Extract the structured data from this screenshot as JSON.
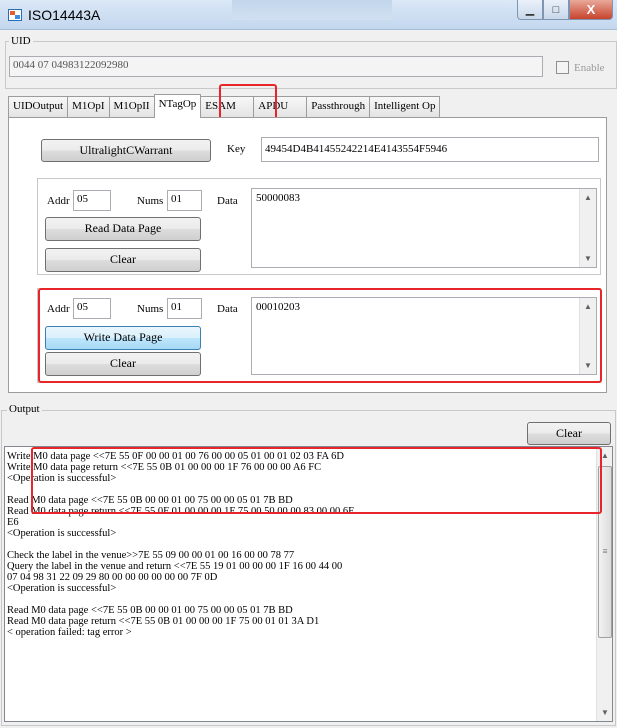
{
  "window": {
    "title": "ISO14443A",
    "controls": {
      "minimize": "▁",
      "maximize": "□",
      "close": "X"
    }
  },
  "uid": {
    "label": "UID",
    "value": "0044 07 04983122092980",
    "enable_label": "Enable",
    "enable_checked": false
  },
  "tabs": [
    {
      "label": "UIDOutput",
      "active": false
    },
    {
      "label": "M1OpI",
      "active": false
    },
    {
      "label": "M1OpII",
      "active": false
    },
    {
      "label": "NTagOp",
      "active": true
    },
    {
      "label": "ESAM",
      "active": false
    },
    {
      "label": "APDU",
      "active": false
    },
    {
      "label": "Passthrough",
      "active": false
    },
    {
      "label": "Intelligent Op",
      "active": false
    }
  ],
  "ntag": {
    "warrant_button": "UltralightCWarrant",
    "key_label": "Key",
    "key_value": "49454D4B41455242214E4143554F5946",
    "read": {
      "addr_label": "Addr",
      "addr_value": "05",
      "nums_label": "Nums",
      "nums_value": "01",
      "data_label": "Data",
      "data_value": "50000083",
      "action_button": "Read Data Page",
      "clear_button": "Clear"
    },
    "write": {
      "addr_label": "Addr",
      "addr_value": "05",
      "nums_label": "Nums",
      "nums_value": "01",
      "data_label": "Data",
      "data_value": "00010203",
      "action_button": "Write Data Page",
      "clear_button": "Clear"
    }
  },
  "output": {
    "label": "Output",
    "clear_button": "Clear",
    "lines": [
      "Write M0 data page <<7E 55 0F 00 00 01 00 76 00 00 05 01 00 01 02 03 FA 6D",
      "Write M0 data page return <<7E 55 0B 01 00 00 00 1F 76 00 00 00 A6 FC",
      "<Operation is successful>",
      "",
      "Read M0 data page <<7E 55 0B 00 00 01 00 75 00 00 05 01 7B BD",
      "Read M0 data page return <<7E 55 0F 01 00 00 00 1F 75 00 50 00 00 83 00 00 6E",
      "E6",
      "<Operation is successful>",
      "",
      "Check the label in the venue>>7E 55 09 00 00 01 00 16 00 00 78 77",
      "Query the label in the venue and return <<7E 55 19 01 00 00 00 1F 16 00 44 00",
      "07 04 98 31 22 09 29 80 00 00 00 00 00 00 7F 0D",
      "<Operation is successful>",
      "",
      "Read M0 data page <<7E 55 0B 00 00 01 00 75 00 00 05 01 7B BD",
      "Read M0 data page return <<7E 55 0B 01 00 00 00 1F 75 00 01 01 3A D1",
      "< operation failed: tag error >"
    ]
  },
  "colors": {
    "highlight": "#e8252a",
    "accent_button": "#bee6fd"
  }
}
